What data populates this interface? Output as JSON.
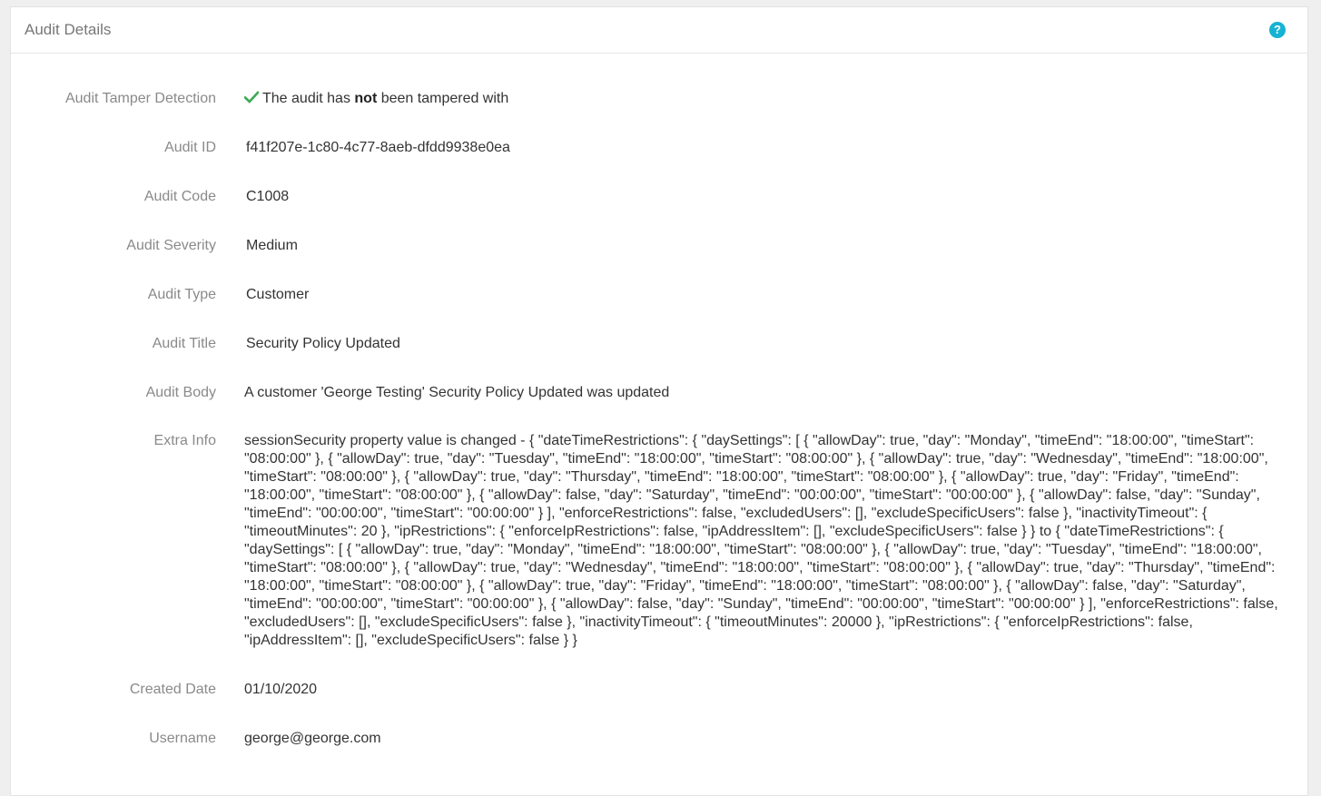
{
  "panel": {
    "title": "Audit Details",
    "help_icon": "question-circle-icon",
    "accent_color": "#17b3d3",
    "check_color": "#3cab54"
  },
  "fields": {
    "tamper": {
      "label": "Audit Tamper Detection",
      "value_prefix": "The audit has ",
      "value_bold": "not",
      "value_suffix": " been tampered with"
    },
    "audit_id": {
      "label": "Audit ID",
      "value": "f41f207e-1c80-4c77-8aeb-dfdd9938e0ea"
    },
    "audit_code": {
      "label": "Audit Code",
      "value": "C1008"
    },
    "audit_severity": {
      "label": "Audit Severity",
      "value": "Medium"
    },
    "audit_type": {
      "label": "Audit Type",
      "value": "Customer"
    },
    "audit_title": {
      "label": "Audit Title",
      "value": "Security Policy Updated"
    },
    "audit_body": {
      "label": "Audit Body",
      "value": "A customer 'George Testing' Security Policy Updated was updated"
    },
    "extra_info": {
      "label": "Extra Info",
      "value": "sessionSecurity property value is changed - { \"dateTimeRestrictions\": { \"daySettings\": [ { \"allowDay\": true, \"day\": \"Monday\", \"timeEnd\": \"18:00:00\", \"timeStart\": \"08:00:00\" }, { \"allowDay\": true, \"day\": \"Tuesday\", \"timeEnd\": \"18:00:00\", \"timeStart\": \"08:00:00\" }, { \"allowDay\": true, \"day\": \"Wednesday\", \"timeEnd\": \"18:00:00\", \"timeStart\": \"08:00:00\" }, { \"allowDay\": true, \"day\": \"Thursday\", \"timeEnd\": \"18:00:00\", \"timeStart\": \"08:00:00\" }, { \"allowDay\": true, \"day\": \"Friday\", \"timeEnd\": \"18:00:00\", \"timeStart\": \"08:00:00\" }, { \"allowDay\": false, \"day\": \"Saturday\", \"timeEnd\": \"00:00:00\", \"timeStart\": \"00:00:00\" }, { \"allowDay\": false, \"day\": \"Sunday\", \"timeEnd\": \"00:00:00\", \"timeStart\": \"00:00:00\" } ], \"enforceRestrictions\": false, \"excludedUsers\": [], \"excludeSpecificUsers\": false }, \"inactivityTimeout\": { \"timeoutMinutes\": 20 }, \"ipRestrictions\": { \"enforceIpRestrictions\": false, \"ipAddressItem\": [], \"excludeSpecificUsers\": false } } to { \"dateTimeRestrictions\": { \"daySettings\": [ { \"allowDay\": true, \"day\": \"Monday\", \"timeEnd\": \"18:00:00\", \"timeStart\": \"08:00:00\" }, { \"allowDay\": true, \"day\": \"Tuesday\", \"timeEnd\": \"18:00:00\", \"timeStart\": \"08:00:00\" }, { \"allowDay\": true, \"day\": \"Wednesday\", \"timeEnd\": \"18:00:00\", \"timeStart\": \"08:00:00\" }, { \"allowDay\": true, \"day\": \"Thursday\", \"timeEnd\": \"18:00:00\", \"timeStart\": \"08:00:00\" }, { \"allowDay\": true, \"day\": \"Friday\", \"timeEnd\": \"18:00:00\", \"timeStart\": \"08:00:00\" }, { \"allowDay\": false, \"day\": \"Saturday\", \"timeEnd\": \"00:00:00\", \"timeStart\": \"00:00:00\" }, { \"allowDay\": false, \"day\": \"Sunday\", \"timeEnd\": \"00:00:00\", \"timeStart\": \"00:00:00\" } ], \"enforceRestrictions\": false, \"excludedUsers\": [], \"excludeSpecificUsers\": false }, \"inactivityTimeout\": { \"timeoutMinutes\": 20000 }, \"ipRestrictions\": { \"enforceIpRestrictions\": false, \"ipAddressItem\": [], \"excludeSpecificUsers\": false } }"
    },
    "created_date": {
      "label": "Created Date",
      "value": "01/10/2020"
    },
    "username": {
      "label": "Username",
      "value": "george@george.com"
    }
  }
}
